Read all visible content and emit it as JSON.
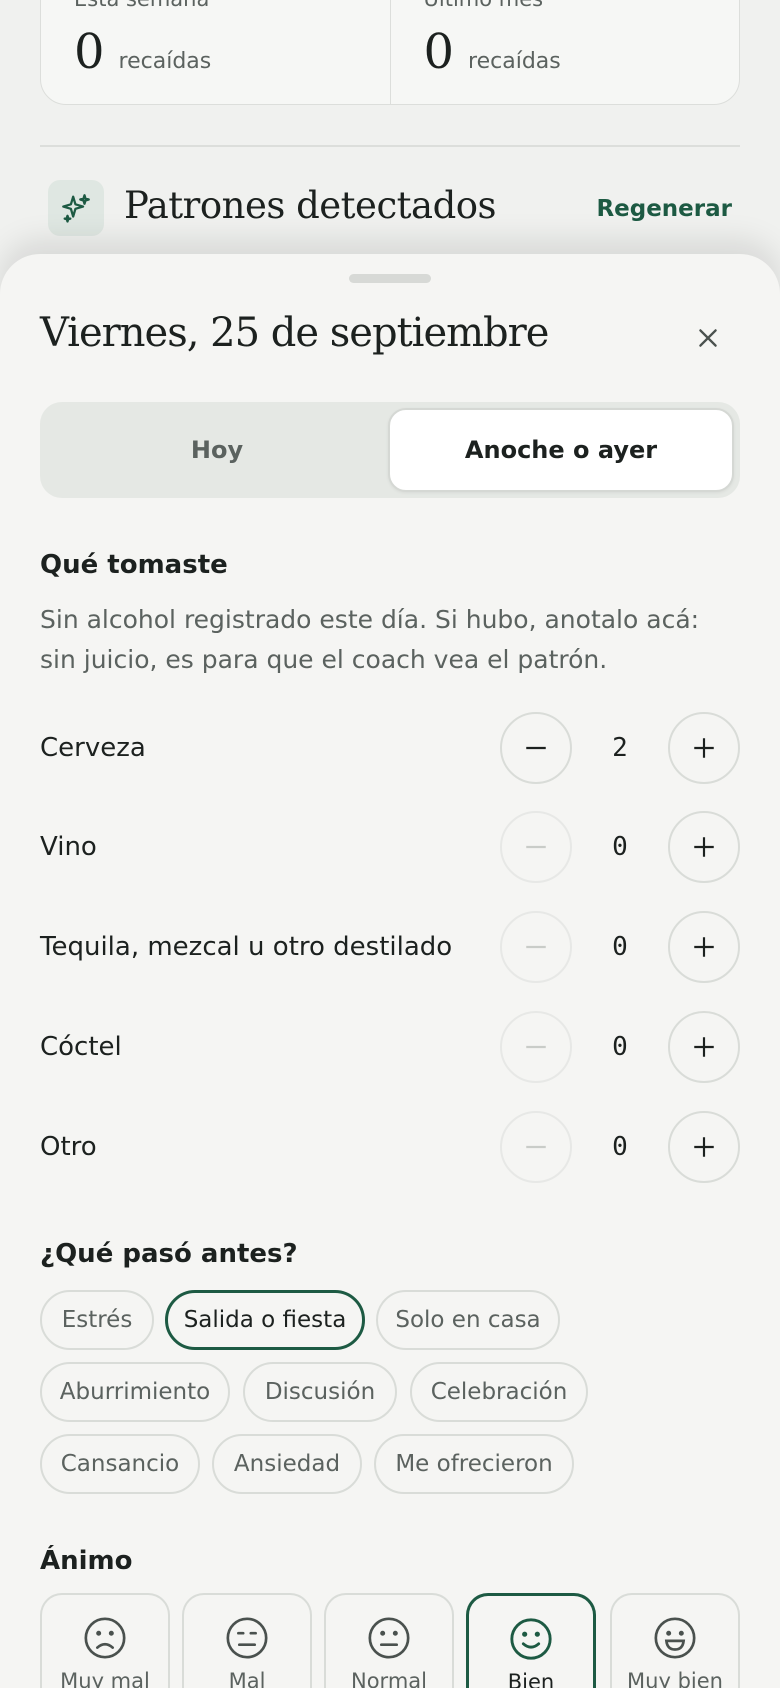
{
  "stats": [
    {
      "label": "Esta semana",
      "value": "0",
      "unit": "recaídas"
    },
    {
      "label": "Último mes",
      "value": "0",
      "unit": "recaídas"
    }
  ],
  "patterns": {
    "title": "Patrones detectados",
    "action": "Regenerar",
    "icon": "sparkles-icon"
  },
  "sheet": {
    "title": "Viernes, 25 de septiembre",
    "close_icon": "close-icon",
    "tabs": [
      {
        "label": "Hoy",
        "active": false
      },
      {
        "label": "Anoche o ayer",
        "active": true
      }
    ]
  },
  "drinks": {
    "heading": "Qué tomaste",
    "helper": "Sin alcohol registrado este día. Si hubo, anotalo acá: sin juicio, es para que el coach vea el patrón.",
    "items": [
      {
        "label": "Cerveza",
        "count": "2"
      },
      {
        "label": "Vino",
        "count": "0"
      },
      {
        "label": "Tequila, mezcal u otro destilado",
        "count": "0"
      },
      {
        "label": "Cóctel",
        "count": "0"
      },
      {
        "label": "Otro",
        "count": "0"
      }
    ]
  },
  "triggers": {
    "heading": "¿Qué pasó antes?",
    "chips": [
      {
        "label": "Estrés",
        "selected": false
      },
      {
        "label": "Salida o fiesta",
        "selected": true
      },
      {
        "label": "Solo en casa",
        "selected": false
      },
      {
        "label": "Aburrimiento",
        "selected": false
      },
      {
        "label": "Discusión",
        "selected": false
      },
      {
        "label": "Celebración",
        "selected": false
      },
      {
        "label": "Cansancio",
        "selected": false
      },
      {
        "label": "Ansiedad",
        "selected": false
      },
      {
        "label": "Me ofrecieron",
        "selected": false
      }
    ]
  },
  "mood": {
    "heading": "Ánimo",
    "options": [
      {
        "label": "Muy mal",
        "icon": "very-sad-face-icon",
        "selected": false
      },
      {
        "label": "Mal",
        "icon": "sad-face-icon",
        "selected": false
      },
      {
        "label": "Normal",
        "icon": "neutral-face-icon",
        "selected": false
      },
      {
        "label": "Bien",
        "icon": "smile-face-icon",
        "selected": true
      },
      {
        "label": "Muy bien",
        "icon": "grin-face-icon",
        "selected": false
      }
    ]
  },
  "colors": {
    "accent": "#1d5a43",
    "background": "#f5f5f3",
    "muted_text": "#5b625f"
  }
}
